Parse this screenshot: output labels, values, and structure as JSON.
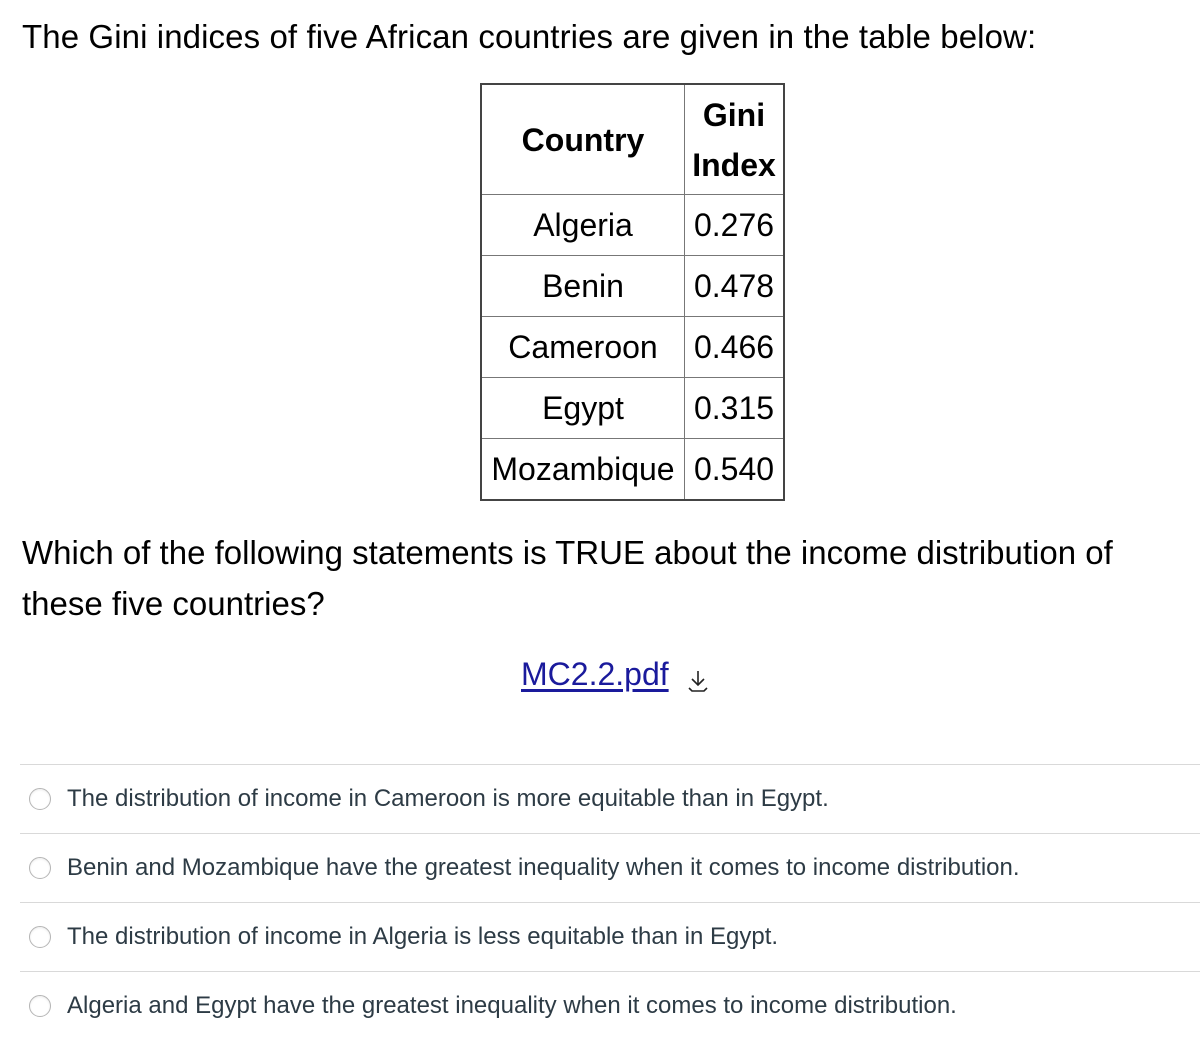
{
  "intro": "The Gini indices of five African countries are given in the table below:",
  "table": {
    "headers": [
      "Country",
      "Gini Index"
    ],
    "header_lines": {
      "country": "Country",
      "gini_line1": "Gini",
      "gini_line2": "Index"
    },
    "rows": [
      {
        "country": "Algeria",
        "gini": "0.276"
      },
      {
        "country": "Benin",
        "gini": "0.478"
      },
      {
        "country": "Cameroon",
        "gini": "0.466"
      },
      {
        "country": "Egypt",
        "gini": "0.315"
      },
      {
        "country": "Mozambique",
        "gini": "0.540"
      }
    ]
  },
  "question": "Which of the following statements is TRUE about the income distribution of these five countries?",
  "attachment": {
    "filename": "MC2.2.pdf",
    "icon": "download-icon",
    "link_color": "#1a1a9c"
  },
  "answers": [
    {
      "label": "The distribution of income in Cameroon is more equitable than in Egypt.",
      "selected": false
    },
    {
      "label": "Benin and Mozambique have the greatest inequality when it comes to income distribution.",
      "selected": false
    },
    {
      "label": "The distribution of income in Algeria is less equitable than in Egypt.",
      "selected": false
    },
    {
      "label": "Algeria and Egypt have the greatest inequality when it comes to income distribution.",
      "selected": false
    }
  ]
}
